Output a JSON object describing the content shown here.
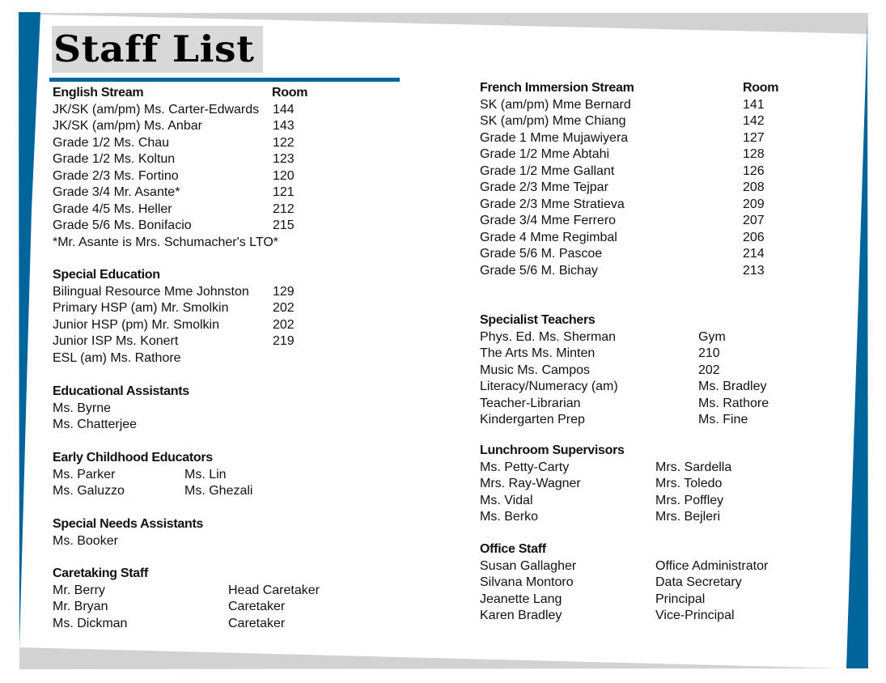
{
  "title": "Staff List",
  "colors": {
    "accent": "#00659b",
    "frame_gray": "#d2d2d2",
    "title_bg": "#d9d9d9"
  },
  "english_stream": {
    "heading": "English Stream",
    "col_heading": "Room",
    "rows": [
      {
        "name": "JK/SK (am/pm) Ms. Carter-Edwards",
        "room": "144"
      },
      {
        "name": "JK/SK (am/pm) Ms. Anbar",
        "room": "143"
      },
      {
        "name": "Grade 1/2 Ms. Chau",
        "room": "122"
      },
      {
        "name": "Grade 1/2 Ms. Koltun",
        "room": "123"
      },
      {
        "name": "Grade 2/3 Ms. Fortino",
        "room": "120"
      },
      {
        "name": "Grade 3/4 Mr. Asante*",
        "room": "121"
      },
      {
        "name": "Grade 4/5 Ms. Heller",
        "room": "212"
      },
      {
        "name": "Grade 5/6 Ms. Bonifacio",
        "room": "215"
      }
    ],
    "note": "*Mr. Asante is Mrs. Schumacher's LTO*"
  },
  "special_education": {
    "heading": "Special Education",
    "rows": [
      {
        "name": "Bilingual Resource Mme Johnston",
        "room": "129"
      },
      {
        "name": "Primary HSP (am)  Mr. Smolkin",
        "room": "202"
      },
      {
        "name": "Junior HSP (pm) Mr. Smolkin",
        "room": "202"
      },
      {
        "name": "Junior ISP Ms. Konert",
        "room": "219"
      },
      {
        "name": "ESL (am) Ms. Rathore",
        "room": ""
      }
    ]
  },
  "educational_assistants": {
    "heading": "Educational Assistants",
    "names": [
      "Ms. Byrne",
      "Ms. Chatterjee"
    ]
  },
  "early_childhood_educators": {
    "heading": "Early Childhood Educators",
    "rows": [
      {
        "left": "Ms. Parker",
        "right": "Ms. Lin"
      },
      {
        "left": "Ms. Galuzzo",
        "right": "Ms. Ghezali"
      }
    ]
  },
  "special_needs_assistants": {
    "heading": "Special Needs Assistants",
    "names": [
      "Ms. Booker"
    ]
  },
  "caretaking_staff": {
    "heading": "Caretaking Staff",
    "rows": [
      {
        "name": "Mr. Berry",
        "role": "Head Caretaker"
      },
      {
        "name": "Mr. Bryan",
        "role": "Caretaker"
      },
      {
        "name": "Ms. Dickman",
        "role": "Caretaker"
      }
    ]
  },
  "french_immersion_stream": {
    "heading": "French Immersion Stream",
    "col_heading": "Room",
    "rows": [
      {
        "name": "SK (am/pm) Mme Bernard",
        "room": "141"
      },
      {
        "name": "SK (am/pm) Mme Chiang",
        "room": "142"
      },
      {
        "name": "Grade 1 Mme Mujawiyera",
        "room": "127"
      },
      {
        "name": "Grade 1/2 Mme Abtahi",
        "room": "128"
      },
      {
        "name": "Grade 1/2 Mme Gallant",
        "room": "126"
      },
      {
        "name": "Grade 2/3 Mme Tejpar",
        "room": "208"
      },
      {
        "name": "Grade 2/3 Mme Stratieva",
        "room": "209"
      },
      {
        "name": "Grade 3/4 Mme Ferrero",
        "room": "207"
      },
      {
        "name": "Grade 4 Mme Regimbal",
        "room": "206"
      },
      {
        "name": "Grade 5/6 M. Pascoe",
        "room": "214"
      },
      {
        "name": "Grade 5/6 M. Bichay",
        "room": "213"
      }
    ]
  },
  "specialist_teachers": {
    "heading": "Specialist Teachers",
    "rows": [
      {
        "name": "Phys. Ed. Ms. Sherman",
        "value": "Gym"
      },
      {
        "name": "The Arts Ms. Minten",
        "value": "210"
      },
      {
        "name": "Music Ms. Campos",
        "value": "202"
      },
      {
        "name": "Literacy/Numeracy (am)",
        "value": "Ms. Bradley"
      },
      {
        "name": "Teacher-Librarian",
        "value": "Ms. Rathore"
      },
      {
        "name": "Kindergarten Prep",
        "value": "Ms. Fine"
      }
    ]
  },
  "lunchroom_supervisors": {
    "heading": "Lunchroom Supervisors",
    "rows": [
      {
        "left": "Ms. Petty-Carty",
        "right": "Mrs. Sardella"
      },
      {
        "left": "Mrs. Ray-Wagner",
        "right": "Mrs. Toledo"
      },
      {
        "left": "Ms. Vidal",
        "right": "Mrs. Poffley"
      },
      {
        "left": "Ms. Berko",
        "right": "Mrs. Bejleri"
      }
    ]
  },
  "office_staff": {
    "heading": "Office Staff",
    "rows": [
      {
        "name": "Susan Gallagher",
        "role": "Office Administrator"
      },
      {
        "name": "Silvana Montoro",
        "role": "Data Secretary"
      },
      {
        "name": "Jeanette Lang",
        "role": "Principal"
      },
      {
        "name": "Karen Bradley",
        "role": "Vice-Principal"
      }
    ]
  }
}
